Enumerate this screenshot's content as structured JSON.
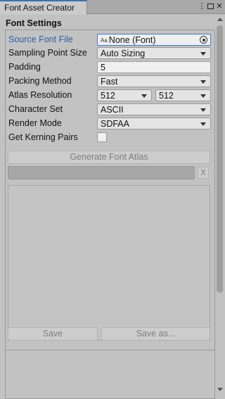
{
  "window": {
    "tab_title": "Font Asset Creator",
    "menu_icon": "kebab-menu-icon",
    "maximize_icon": "maximize-icon",
    "close_icon": "close-icon"
  },
  "settings": {
    "header": "Font Settings",
    "source_font": {
      "label": "Source Font File",
      "value": "None (Font)",
      "icon": "font-asset-icon",
      "picker_icon": "object-picker-icon"
    },
    "sampling_point_size": {
      "label": "Sampling Point Size",
      "value": "Auto Sizing"
    },
    "padding": {
      "label": "Padding",
      "value": "5"
    },
    "packing_method": {
      "label": "Packing Method",
      "value": "Fast"
    },
    "atlas_resolution": {
      "label": "Atlas Resolution",
      "width": "512",
      "height": "512"
    },
    "character_set": {
      "label": "Character Set",
      "value": "ASCII"
    },
    "render_mode": {
      "label": "Render Mode",
      "value": "SDFAA"
    },
    "kerning": {
      "label": "Get Kerning Pairs",
      "checked": false
    }
  },
  "actions": {
    "generate": "Generate Font Atlas",
    "cancel": "X",
    "save": "Save",
    "save_as": "Save as..."
  },
  "colors": {
    "accent": "#3a72b0",
    "active_label": "#2a5fa6",
    "panel_bg": "#c2c2c2"
  }
}
